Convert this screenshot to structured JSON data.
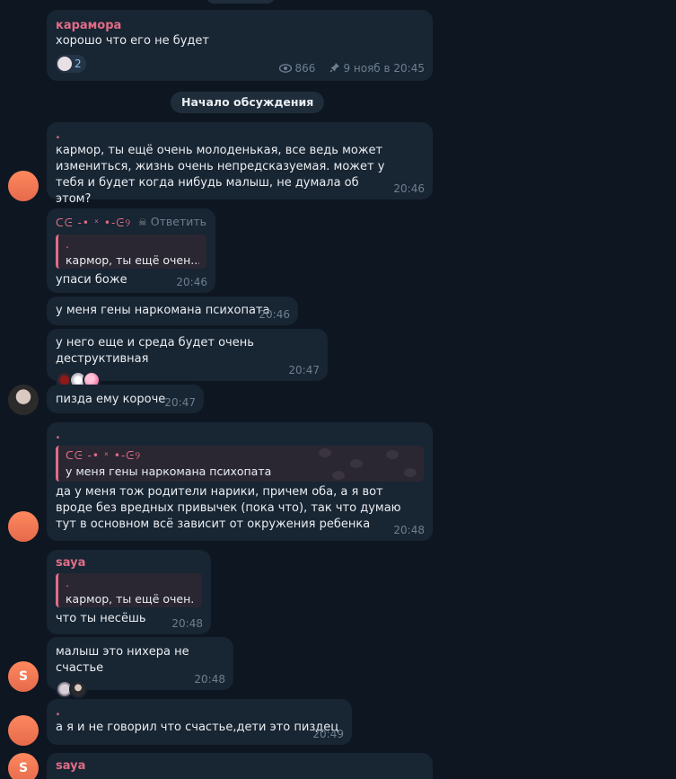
{
  "top_pill": "",
  "messages": [
    {
      "sender": "карамора",
      "text": "хорошо что его не будет",
      "reaction_count": "2",
      "views": "866",
      "time": "9 нояб в 20:45"
    }
  ],
  "divider": "Начало обсуждения",
  "m1": {
    "sender": ".",
    "text": "кармор, ты ещё очень молоденькая, все ведь может измениться, жизнь очень непредсказуемая. может у тебя и будет когда нибудь малыш, не думала об этом?",
    "time": "20:46"
  },
  "m2": {
    "sender": "ᑕᕮ -• ˣ •-ᕮ୨",
    "reply_label": "Ответить",
    "quote_name": ".",
    "quote_text": "кармор, ты ещё очен...",
    "text": "упаси боже",
    "time": "20:46"
  },
  "m3": {
    "text": "у меня гены наркомана психопата",
    "time": "20:46"
  },
  "m4": {
    "text": "у него еще и среда будет очень деструктивная",
    "time": "20:47"
  },
  "m5": {
    "text": "пизда ему короче",
    "time": "20:47"
  },
  "m6": {
    "sender": ".",
    "quote_name": "ᑕᕮ -• ˣ •-ᕮ୨",
    "quote_text": "у меня гены наркомана психопата",
    "text": "да у меня тож родители нарики, причем оба, а я вот вроде без вредных привычек (пока что), так что думаю тут в основном всё зависит от окружения ребенка",
    "time": "20:48"
  },
  "m7": {
    "sender": "saya",
    "quote_name": ".",
    "quote_text": "кармор, ты ещё очен...",
    "text": "что ты несёшь",
    "time": "20:48"
  },
  "m8": {
    "text": "малыш это нихера не счастье",
    "time": "20:48",
    "avatar_letter": "S"
  },
  "m9": {
    "sender": ".",
    "text": "а я и не говорил что счастье,дети это пиздец",
    "time": "20:49"
  },
  "m10": {
    "sender": "saya",
    "avatar_letter": "S"
  },
  "colors": {
    "bg": "#0e1621",
    "bubble": "#182533",
    "accent_pink": "#e16c86",
    "meta": "#6d7f8f"
  }
}
